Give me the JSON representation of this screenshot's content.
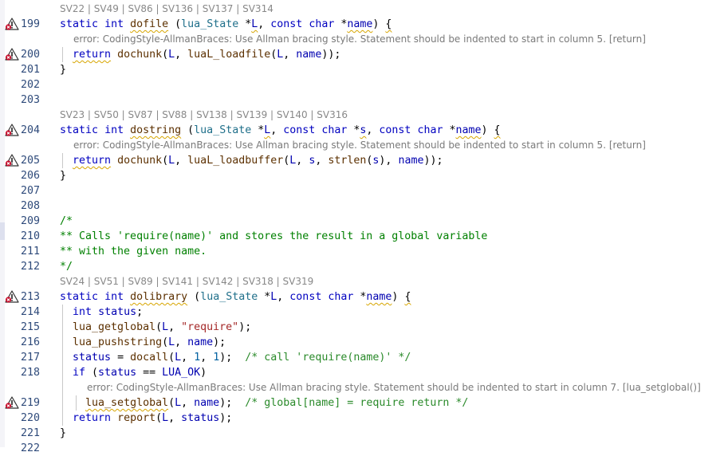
{
  "colors": {
    "keyword": "#0000c0",
    "function": "#5c3000",
    "type": "#1f6f8a",
    "comment": "#2a8a2a",
    "string": "#a52a2a",
    "line_number": "#2e4a7a",
    "error_text": "#7a7a7a",
    "warning_icon": "warning-error-icon"
  },
  "lines": [
    {
      "kind": "annot",
      "text": "SV22 | SV49 | SV86 | SV136 | SV137 | SV314"
    },
    {
      "kind": "code",
      "num": "199",
      "icon": true,
      "html": "<span class='kw'>static</span> <span class='kw'>int</span> <span class='fn sq'>dofile</span> (<span class='ty'>lua_State</span> *<span class='var sq'>L</span>, <span class='kw'>const</span> <span class='kw'>char</span> *<span class='var sq'>name</span>) <span class='sq'>{</span>"
    },
    {
      "kind": "msg",
      "indent": 92,
      "text": "error: CodingStyle-AllmanBraces: Use Allman bracing style. Statement should be indented to start in column 5. [return]"
    },
    {
      "kind": "code",
      "num": "200",
      "icon": true,
      "guides": [
        78
      ],
      "html": "  <span class='kw sq'>return</span> <span class='fn'>dochunk</span>(<span class='var'>L</span>, <span class='fn'>luaL_loadfile</span>(<span class='var'>L</span>, <span class='var'>name</span>));"
    },
    {
      "kind": "code",
      "num": "201",
      "html": "}"
    },
    {
      "kind": "code",
      "num": "202",
      "html": ""
    },
    {
      "kind": "code",
      "num": "203",
      "html": ""
    },
    {
      "kind": "annot",
      "text": "SV23 | SV50 | SV87 | SV88 | SV138 | SV139 | SV140 | SV316"
    },
    {
      "kind": "code",
      "num": "204",
      "icon": true,
      "html": "<span class='kw'>static</span> <span class='kw'>int</span> <span class='fn sq'>dostring</span> (<span class='ty'>lua_State</span> *<span class='var sq'>L</span>, <span class='kw'>const</span> <span class='kw'>char</span> *<span class='var sq'>s</span>, <span class='kw'>const</span> <span class='kw'>char</span> *<span class='var sq'>name</span>) <span class='sq'>{</span>"
    },
    {
      "kind": "msg",
      "indent": 92,
      "text": "error: CodingStyle-AllmanBraces: Use Allman bracing style. Statement should be indented to start in column 5. [return]"
    },
    {
      "kind": "code",
      "num": "205",
      "icon": true,
      "guides": [
        78
      ],
      "html": "  <span class='kw sq'>return</span> <span class='fn'>dochunk</span>(<span class='var'>L</span>, <span class='fn'>luaL_loadbuffer</span>(<span class='var'>L</span>, <span class='var'>s</span>, <span class='fn'>strlen</span>(<span class='var'>s</span>), <span class='var'>name</span>));"
    },
    {
      "kind": "code",
      "num": "206",
      "html": "}"
    },
    {
      "kind": "code",
      "num": "207",
      "html": ""
    },
    {
      "kind": "code",
      "num": "208",
      "html": ""
    },
    {
      "kind": "code",
      "num": "209",
      "html": "<span class='mc'>/*</span>"
    },
    {
      "kind": "code",
      "num": "210",
      "html": "<span class='mc'>** Calls 'require(name)' and stores the result in a global variable</span>"
    },
    {
      "kind": "code",
      "num": "211",
      "html": "<span class='mc'>** with the given name.</span>"
    },
    {
      "kind": "code",
      "num": "212",
      "html": "<span class='mc'>*/</span>"
    },
    {
      "kind": "annot",
      "text": "SV24 | SV51 | SV89 | SV141 | SV142 | SV318 | SV319"
    },
    {
      "kind": "code",
      "num": "213",
      "icon": true,
      "html": "<span class='kw'>static</span> <span class='kw'>int</span> <span class='fn sq'>dolibrary</span> (<span class='ty'>lua_State</span> *<span class='var'>L</span>, <span class='kw'>const</span> <span class='kw'>char</span> *<span class='var sq'>name</span>) <span class='sq'>{</span>"
    },
    {
      "kind": "code",
      "num": "214",
      "guides": [
        78
      ],
      "html": "  <span class='kw'>int</span> <span class='var'>status</span>;"
    },
    {
      "kind": "code",
      "num": "215",
      "guides": [
        78
      ],
      "html": "  <span class='fn'>lua_getglobal</span>(<span class='var'>L</span>, <span class='str'>\"require\"</span>);"
    },
    {
      "kind": "code",
      "num": "216",
      "guides": [
        78
      ],
      "html": "  <span class='fn'>lua_pushstring</span>(<span class='var'>L</span>, <span class='var'>name</span>);"
    },
    {
      "kind": "code",
      "num": "217",
      "guides": [
        78
      ],
      "html": "  <span class='var'>status</span> = <span class='fn'>docall</span>(<span class='var'>L</span>, <span class='num'>1</span>, <span class='num'>1</span>);  <span class='cm'>/* call 'require(name)' */</span>"
    },
    {
      "kind": "code",
      "num": "218",
      "guides": [
        78
      ],
      "html": "  <span class='kw'>if</span> (<span class='var'>status</span> == <span class='var'>LUA_OK</span>)"
    },
    {
      "kind": "msg",
      "indent": 109,
      "guides": [
        78
      ],
      "text": "error: CodingStyle-AllmanBraces: Use Allman bracing style. Statement should be indented to start in column 7. [lua_setglobal()]"
    },
    {
      "kind": "code",
      "num": "219",
      "icon": true,
      "guides": [
        78,
        95
      ],
      "html": "    <span class='fn sq'>lua_setglobal</span>(<span class='var'>L</span>, <span class='var'>name</span>);  <span class='cm'>/* global[name] = require return */</span>"
    },
    {
      "kind": "code",
      "num": "220",
      "guides": [
        78
      ],
      "html": "  <span class='kw'>return</span> <span class='fn'>report</span>(<span class='var'>L</span>, <span class='var'>status</span>);"
    },
    {
      "kind": "code",
      "num": "221",
      "html": "}"
    },
    {
      "kind": "code",
      "num": "222",
      "html": ""
    }
  ]
}
